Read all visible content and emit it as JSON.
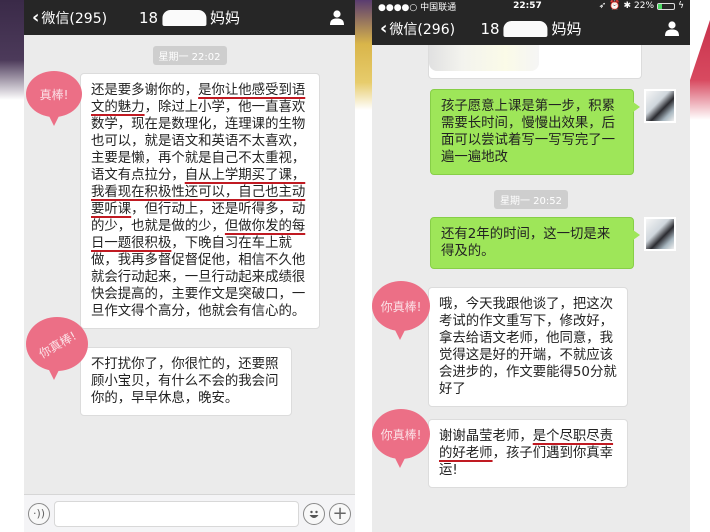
{
  "left_phone": {
    "nav": {
      "back_label": "微信(295)",
      "title_prefix": "18",
      "title_suffix": "妈妈"
    },
    "timestamp": "星期一 22:02",
    "messages": [
      {
        "direction": "incoming",
        "sticker": "真棒!",
        "segments": [
          {
            "text": "还是要多谢你的，",
            "underline": false
          },
          {
            "text": "是你让他感受到语文的魅力",
            "underline": true
          },
          {
            "text": "，除过上小学，他一直喜欢数学，现在是数理化，连理课的生物也可以，就是语文和英语不太喜欢，主要是懒，再个就是自己不太重视，语文有点拉分，",
            "underline": false
          },
          {
            "text": "自从上学期买了课，我看现在积极性还可以，自己也主动要听课",
            "underline": true
          },
          {
            "text": "，但行动上，还是听得多，动的少，也就是做的少，",
            "underline": false
          },
          {
            "text": "但做你发的每日一题很积极",
            "underline": true
          },
          {
            "text": "，下晚自习在车上就做，我再多督促督促他，相信不久他就会行动起来，一旦行动起来成绩很快会提高的，主要作文是突破口，一旦作文得个高分，他就会有信心的。",
            "underline": false
          }
        ]
      },
      {
        "direction": "incoming",
        "sticker": "你真棒!",
        "segments": [
          {
            "text": "不打扰你了，你很忙的，还要照顾小宝贝，有什么不会的我会问你的，早早休息，晚安。",
            "underline": false
          }
        ]
      }
    ],
    "input_bar": {
      "voice_icon": "voice-icon",
      "emoji_icon": "emoji-icon",
      "plus_icon": "plus-icon",
      "input_value": ""
    }
  },
  "right_phone": {
    "status_bar": {
      "carrier": "●●●●○ 中国联通",
      "time": "22:57",
      "battery_text": "22%",
      "battery_level": 0.22
    },
    "nav": {
      "back_label": "微信(296)",
      "title_prefix": "18",
      "title_suffix": "妈妈"
    },
    "timestamp": "星期一 20:52",
    "messages": [
      {
        "direction": "outgoing",
        "text": "孩子愿意上课是第一步，积累需要长时间，慢慢出效果，后面可以尝试着写一写写完了一遍一遍地改"
      },
      {
        "direction": "outgoing",
        "text": "还有2年的时间，这一切是来得及的。"
      },
      {
        "direction": "incoming",
        "sticker": "你真棒!",
        "segments": [
          {
            "text": "哦，今天我跟他谈了，把这次考试的作文重写下，修改好，拿去给语文老师，他同意，我觉得这是好的开端，不就应该会进步的，作文要能得50分就好了",
            "underline": false
          }
        ]
      },
      {
        "direction": "incoming",
        "sticker": "你真棒!",
        "segments": [
          {
            "text": "谢谢晶莹老师，",
            "underline": false
          },
          {
            "text": "是个尽职尽责的好老师",
            "underline": true
          },
          {
            "text": "，孩子们遇到你真幸运!",
            "underline": false
          }
        ]
      }
    ]
  },
  "colors": {
    "nav_bg": "#262626",
    "chat_bg": "#ebebeb",
    "outgoing_bubble": "#9ee659",
    "incoming_bubble": "#ffffff",
    "sticker": "#ec6f86",
    "underline": "#c01a22"
  }
}
